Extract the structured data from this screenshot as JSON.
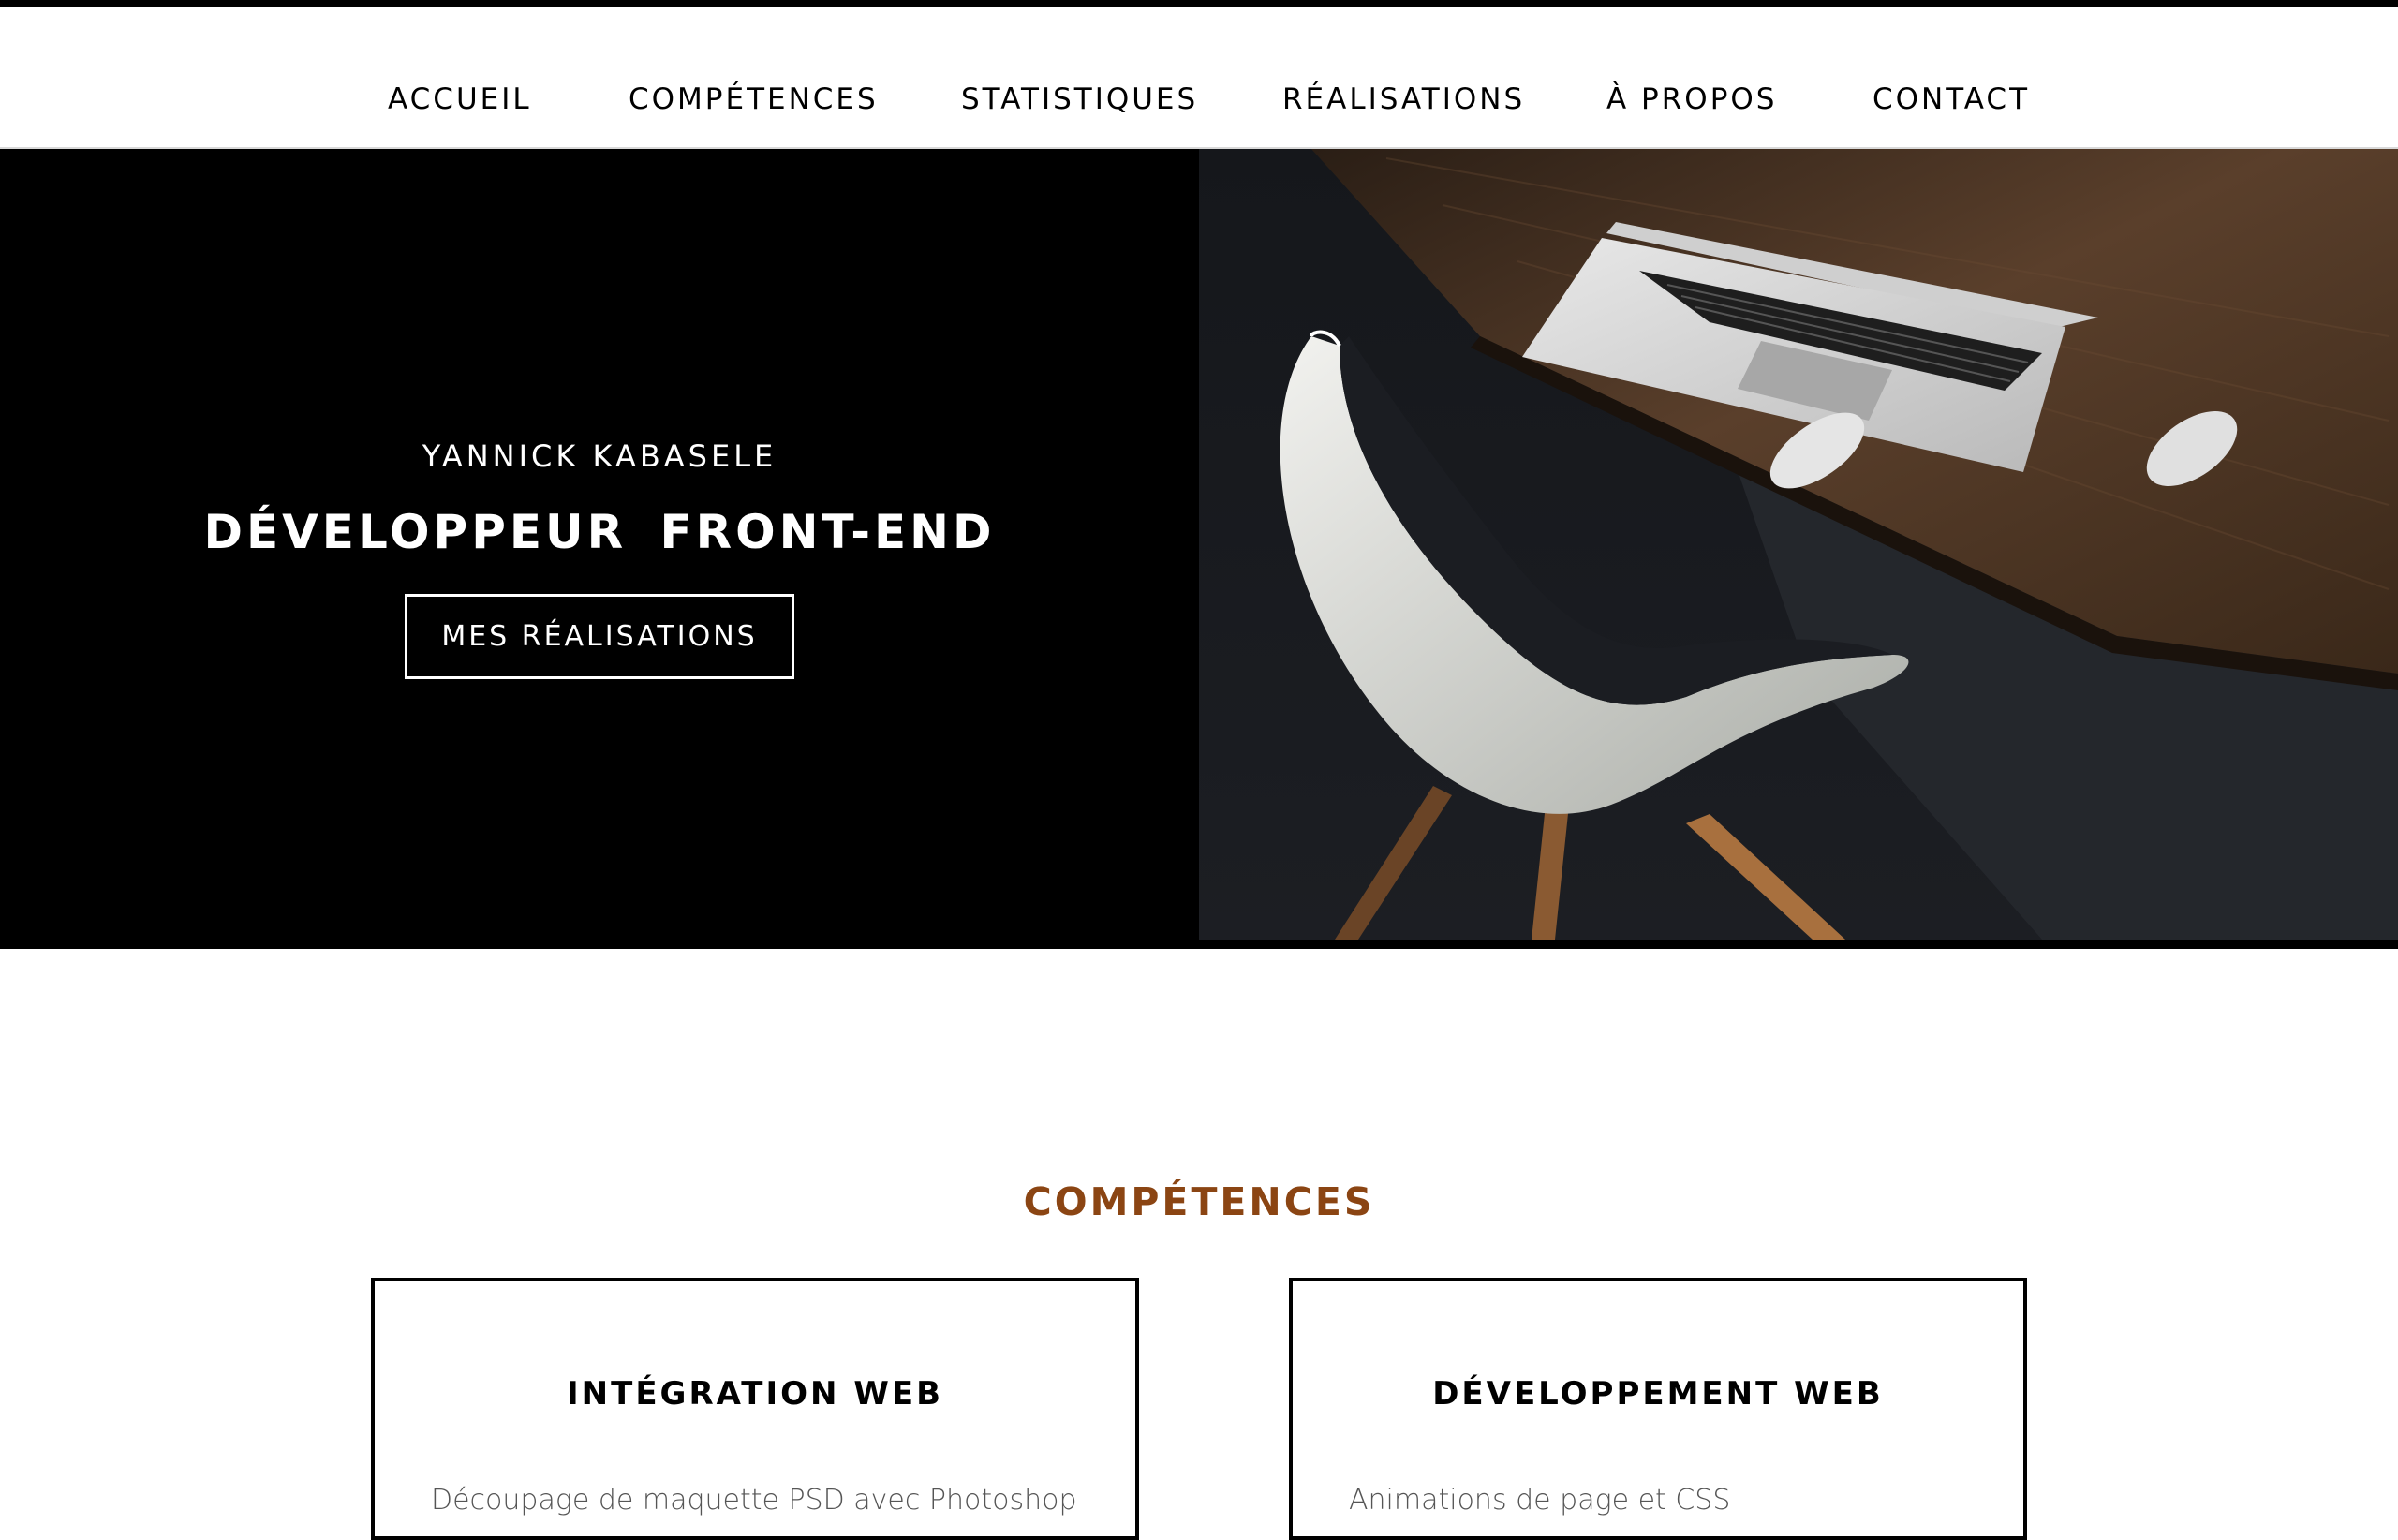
{
  "nav": {
    "items": [
      {
        "label": "ACCUEIL"
      },
      {
        "label": "COMPÉTENCES"
      },
      {
        "label": "STATISTIQUES"
      },
      {
        "label": "RÉALISATIONS"
      },
      {
        "label": "À PROPOS"
      },
      {
        "label": "CONTACT"
      }
    ]
  },
  "hero": {
    "name": "YANNICK KABASELE",
    "title": "DÉVELOPPEUR  FRONT-END",
    "button_label": "MES RÉALISATIONS",
    "photo_subject": "white chair next to wooden desk with laptop and mouse"
  },
  "skills": {
    "title": "COMPÉTENCES",
    "cards": [
      {
        "title": "INTÉGRATION WEB",
        "text": "Découpage de maquette PSD avec Photoshop"
      },
      {
        "title": "DÉVELOPPEMENT WEB",
        "text": "Animations de page et CSS"
      }
    ]
  },
  "colors": {
    "accent": "#8b4513",
    "hero_bg": "#000000",
    "nav_text": "#000000"
  }
}
